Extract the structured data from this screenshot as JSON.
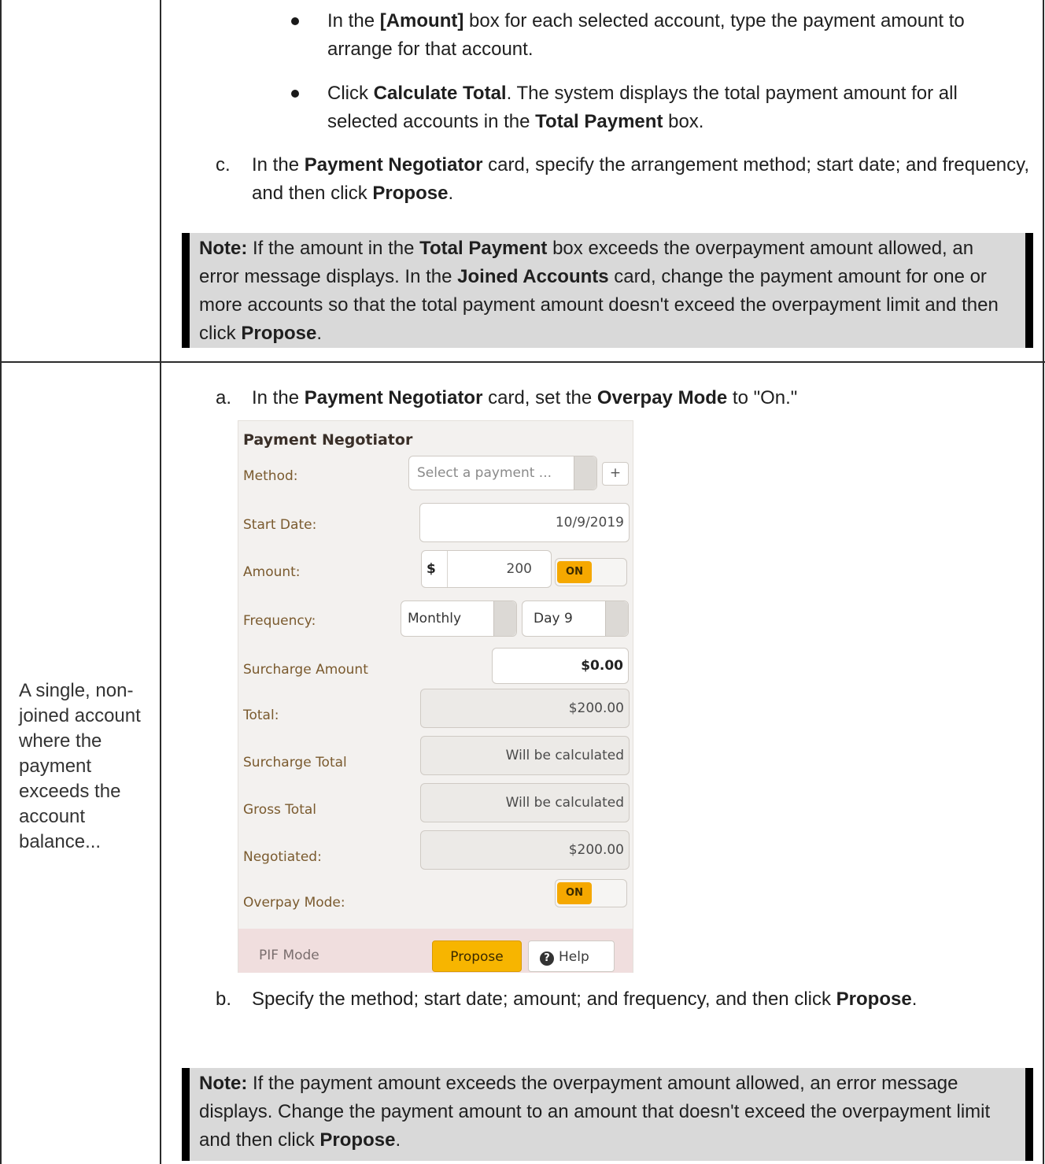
{
  "row1": {
    "bullets": [
      {
        "p1": "In the ",
        "b1": "[Amount]",
        "p2": " box for each selected account, type the payment amount to arrange for that account."
      },
      {
        "p1": "Click ",
        "b1": "Calculate Total",
        "p2": ". The system displays the total payment amount for all selected accounts in the ",
        "b2": "Total Payment",
        "p3": " box."
      }
    ],
    "step_c": {
      "letter": "c.",
      "p1": "In the ",
      "b1": "Payment Negotiator",
      "p2": " card, specify the arrangement method; start date; and frequency, and then click ",
      "b2": "Propose",
      "p3": "."
    },
    "note": {
      "label": "Note:",
      "p1": " If the amount in the ",
      "b1": "Total Payment",
      "p2": " box exceeds the overpayment amount allowed, an error message displays. In the ",
      "b2": "Joined Accounts",
      "p3": " card, change the payment amount for one or more accounts so that the total payment amount doesn't exceed the overpayment limit and then click ",
      "b3": "Propose",
      "p4": "."
    }
  },
  "row2": {
    "left_text": "A single, non-joined account where the payment exceeds the account balance...",
    "step_a": {
      "letter": "a.",
      "p1": "In the ",
      "b1": "Payment Negotiator",
      "p2": " card, set the ",
      "b2": "Overpay Mode",
      "p3": " to \"On.\""
    },
    "card": {
      "title": "Payment Negotiator",
      "method_label": "Method:",
      "method_placeholder": "Select a payment ...",
      "add_label": "+",
      "start_date_label": "Start Date:",
      "start_date": "10/9/2019",
      "amount_label": "Amount:",
      "currency": "$",
      "amount": "200",
      "amount_toggle": "ON",
      "frequency_label": "Frequency:",
      "frequency": "Monthly",
      "day": "Day 9",
      "surcharge_amount_label": "Surcharge Amount",
      "surcharge_amount": "$0.00",
      "total_label": "Total:",
      "total": "$200.00",
      "surcharge_total_label": "Surcharge Total",
      "surcharge_total": "Will be calculated",
      "gross_total_label": "Gross Total",
      "gross_total": "Will be calculated",
      "negotiated_label": "Negotiated:",
      "negotiated": "$200.00",
      "overpay_label": "Overpay Mode:",
      "overpay_toggle": "ON",
      "pif_label": "PIF Mode",
      "propose": "Propose",
      "help": "Help",
      "accent": "#f7b500"
    },
    "step_b": {
      "letter": "b.",
      "p1": "Specify the method; start date; amount; and frequency, and then click ",
      "b1": "Propose",
      "p2": "."
    },
    "note": {
      "label": "Note:",
      "p1": " If the payment amount exceeds the overpayment amount allowed, an error message displays. Change the payment amount to an amount that doesn't exceed the overpayment limit and then click ",
      "b1": "Propose",
      "p2": "."
    }
  }
}
